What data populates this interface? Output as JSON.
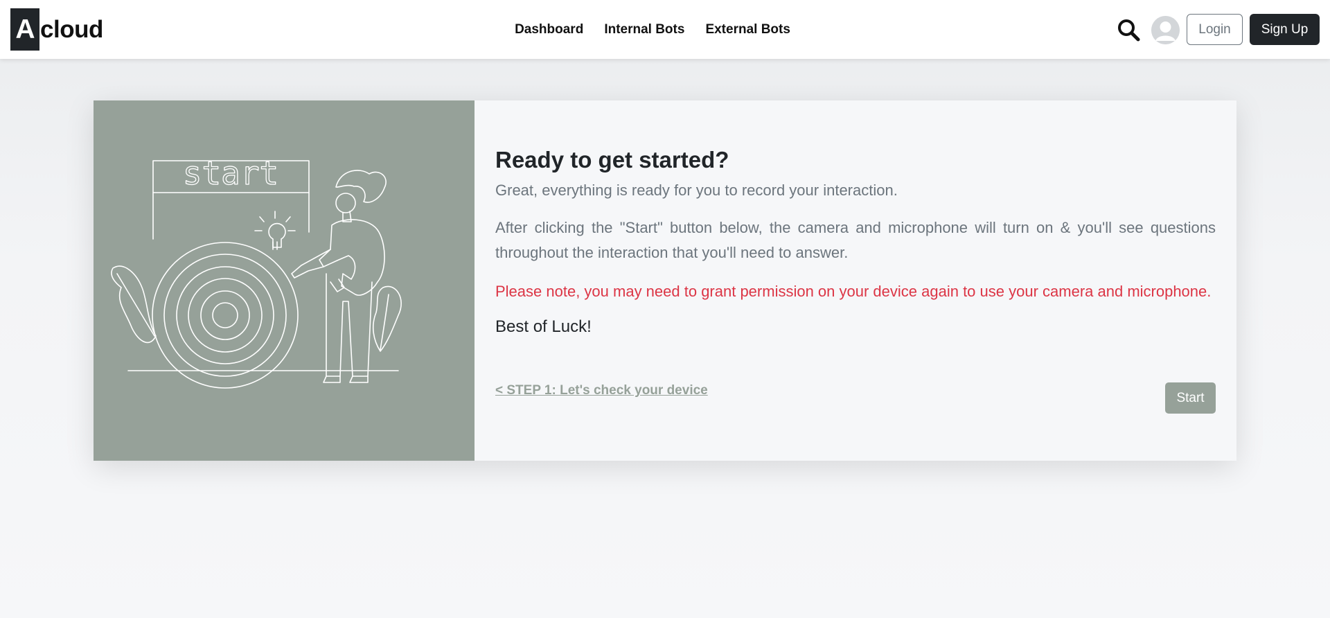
{
  "header": {
    "brand_letter": "A",
    "brand_rest": "cloud",
    "nav": [
      {
        "label": "Dashboard"
      },
      {
        "label": "Internal Bots"
      },
      {
        "label": "External Bots"
      }
    ],
    "search_icon": "search-icon",
    "avatar_icon": "user-avatar-icon",
    "login_label": "Login",
    "signup_label": "Sign Up"
  },
  "card": {
    "illustration": {
      "icon": "start-target-illustration",
      "sign_text": "start"
    },
    "title": "Ready to get started?",
    "lead": "Great, everything is ready for you to record your interaction.",
    "paragraph": "After clicking the \"Start\" button below, the camera and microphone will turn on & you'll see questions throughout the interaction that you'll need to answer.",
    "note": "Please note, you may need to grant permission on your device again to use your camera and microphone.",
    "closing": "Best of Luck!",
    "back_link": "< STEP 1: Let's check your device",
    "start_label": "Start"
  },
  "colors": {
    "brand_dark": "#212529",
    "sage": "#96a199",
    "danger": "#dc3545",
    "muted": "#6c757d"
  }
}
